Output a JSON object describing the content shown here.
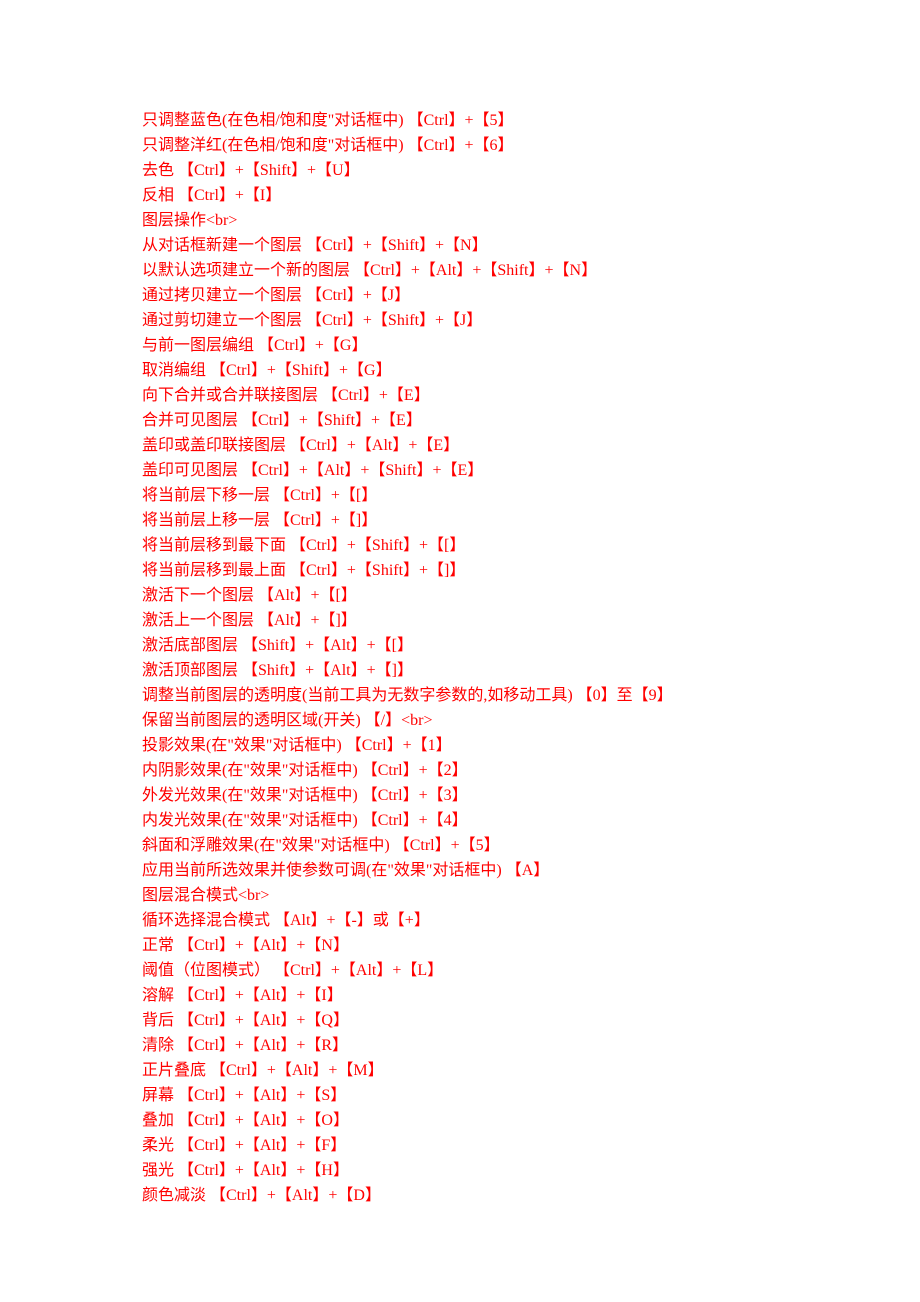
{
  "lines": [
    "只调整蓝色(在色相/饱和度\"对话框中) 【Ctrl】+【5】",
    "只调整洋红(在色相/饱和度\"对话框中) 【Ctrl】+【6】",
    "去色 【Ctrl】+【Shift】+【U】",
    "反相 【Ctrl】+【I】",
    "图层操作<br>",
    "从对话框新建一个图层 【Ctrl】+【Shift】+【N】",
    "以默认选项建立一个新的图层 【Ctrl】+【Alt】+【Shift】+【N】",
    "通过拷贝建立一个图层 【Ctrl】+【J】",
    "通过剪切建立一个图层 【Ctrl】+【Shift】+【J】",
    "与前一图层编组 【Ctrl】+【G】",
    "取消编组 【Ctrl】+【Shift】+【G】",
    "向下合并或合并联接图层 【Ctrl】+【E】",
    "合并可见图层 【Ctrl】+【Shift】+【E】",
    "盖印或盖印联接图层 【Ctrl】+【Alt】+【E】",
    "盖印可见图层 【Ctrl】+【Alt】+【Shift】+【E】",
    "将当前层下移一层 【Ctrl】+【[】",
    "将当前层上移一层 【Ctrl】+【]】",
    "将当前层移到最下面 【Ctrl】+【Shift】+【[】",
    "将当前层移到最上面 【Ctrl】+【Shift】+【]】",
    " 激活下一个图层 【Alt】+【[】",
    "激活上一个图层 【Alt】+【]】",
    "激活底部图层 【Shift】+【Alt】+【[】",
    "激活顶部图层 【Shift】+【Alt】+【]】",
    "调整当前图层的透明度(当前工具为无数字参数的,如移动工具) 【0】至【9】",
    "保留当前图层的透明区域(开关) 【/】<br>",
    "投影效果(在\"效果\"对话框中) 【Ctrl】+【1】",
    "内阴影效果(在\"效果\"对话框中) 【Ctrl】+【2】",
    "外发光效果(在\"效果\"对话框中) 【Ctrl】+【3】",
    "内发光效果(在\"效果\"对话框中) 【Ctrl】+【4】",
    "斜面和浮雕效果(在\"效果\"对话框中) 【Ctrl】+【5】",
    "应用当前所选效果并使参数可调(在\"效果\"对话框中) 【A】",
    "图层混合模式<br>",
    "循环选择混合模式 【Alt】+【-】或【+】",
    "正常 【Ctrl】+【Alt】+【N】",
    "阈值（位图模式） 【Ctrl】+【Alt】+【L】",
    "溶解 【Ctrl】+【Alt】+【I】",
    "背后 【Ctrl】+【Alt】+【Q】",
    "清除 【Ctrl】+【Alt】+【R】",
    "正片叠底 【Ctrl】+【Alt】+【M】",
    "屏幕 【Ctrl】+【Alt】+【S】",
    "叠加 【Ctrl】+【Alt】+【O】",
    "柔光 【Ctrl】+【Alt】+【F】",
    "强光 【Ctrl】+【Alt】+【H】",
    "颜色减淡 【Ctrl】+【Alt】+【D】"
  ]
}
